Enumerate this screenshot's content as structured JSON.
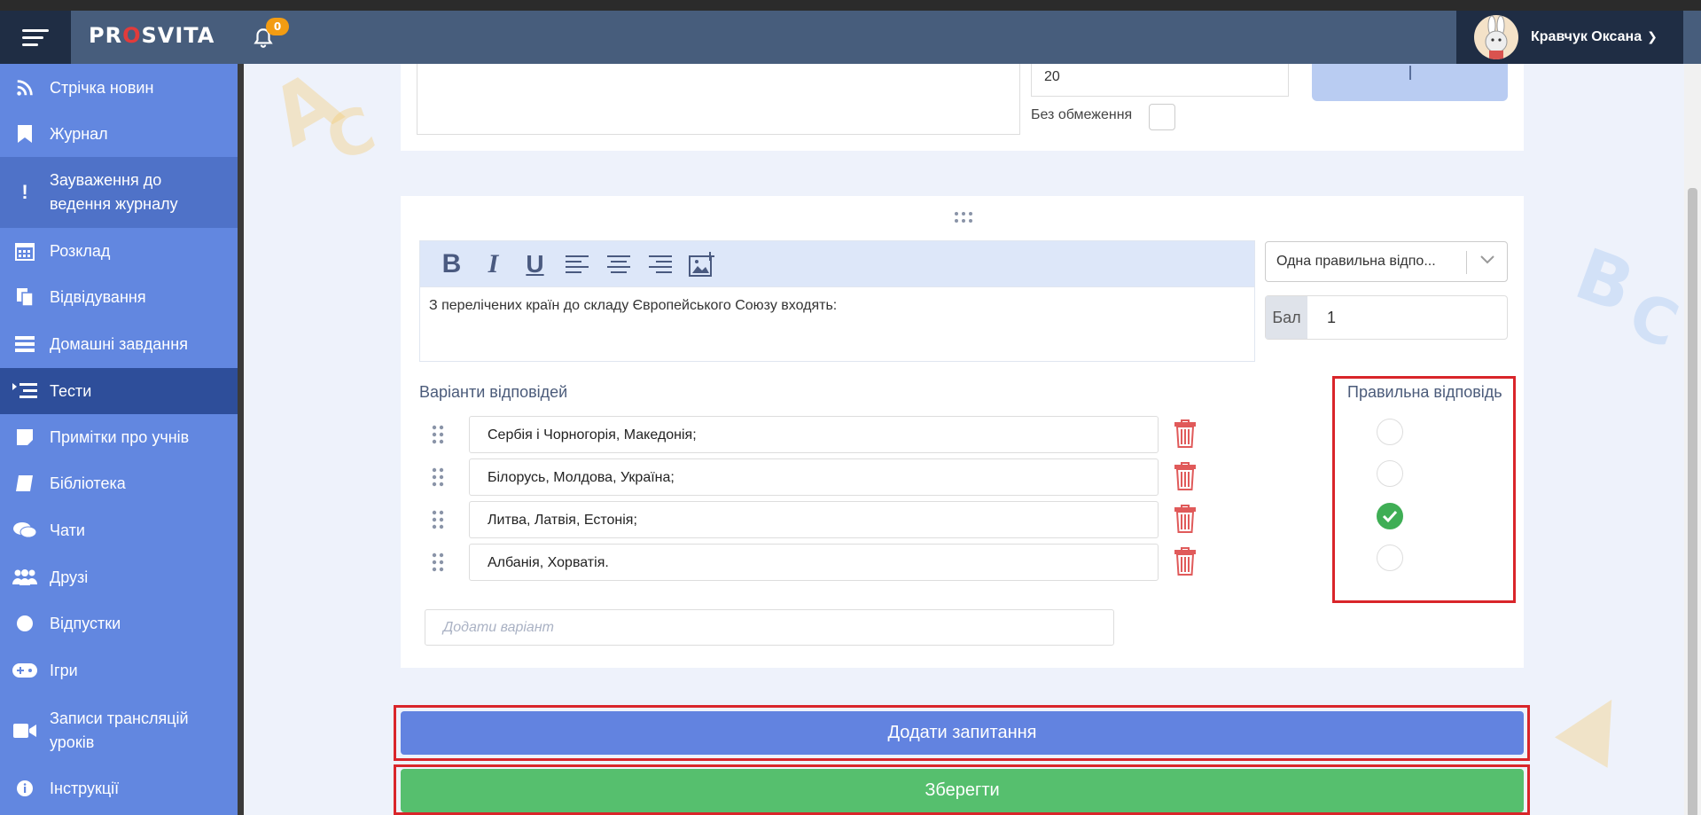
{
  "header": {
    "logo_pre": "PR",
    "logo_o": "O",
    "logo_post": "SVITA",
    "notifications_count": "0",
    "user_name": "Кравчук Оксана"
  },
  "sidebar": {
    "items": [
      {
        "label": "Стрічка новин",
        "icon": "rss-icon"
      },
      {
        "label": "Журнал",
        "icon": "bookmark-icon"
      },
      {
        "label": "Зауваження до ведення журналу",
        "icon": "exclamation-icon"
      },
      {
        "label": "Розклад",
        "icon": "calendar-icon"
      },
      {
        "label": "Відвідування",
        "icon": "copy-icon"
      },
      {
        "label": "Домашні завдання",
        "icon": "tasks-icon"
      },
      {
        "label": "Тести",
        "icon": "list-icon"
      },
      {
        "label": "Примітки про учнів",
        "icon": "note-icon"
      },
      {
        "label": "Бібліотека",
        "icon": "book-icon"
      },
      {
        "label": "Чати",
        "icon": "chat-icon"
      },
      {
        "label": "Друзі",
        "icon": "users-icon"
      },
      {
        "label": "Відпустки",
        "icon": "circle-icon"
      },
      {
        "label": "Ігри",
        "icon": "gamepad-icon"
      },
      {
        "label": "Записи трансляцій уроків",
        "icon": "video-icon"
      },
      {
        "label": "Інструкції",
        "icon": "info-icon"
      }
    ]
  },
  "test_settings": {
    "time_limit_value": "20",
    "no_limit_label": "Без обмеження"
  },
  "question": {
    "text": "З перелічених країн до складу Європейського Союзу входять:",
    "type_selected": "Одна правильна відпо...",
    "score_label": "Бал",
    "score_value": "1",
    "variants_title": "Варіанти відповідей",
    "correct_title": "Правильна відповідь",
    "options": [
      {
        "text": "Сербія і Чорногорія, Македонія;",
        "correct": false
      },
      {
        "text": "Білорусь, Молдова, Україна;",
        "correct": false
      },
      {
        "text": "Литва, Латвія, Естонія;",
        "correct": true
      },
      {
        "text": "Албанія, Хорватія.",
        "correct": false
      }
    ],
    "add_variant_placeholder": "Додати варіант"
  },
  "actions": {
    "add_question": "Додати запитання",
    "save": "Зберегти"
  },
  "colors": {
    "sidebar": "#6287e0",
    "header": "#475d7c",
    "accent_blue": "#6283e0",
    "accent_green": "#56bf6e",
    "highlight_red": "#d9252a"
  }
}
